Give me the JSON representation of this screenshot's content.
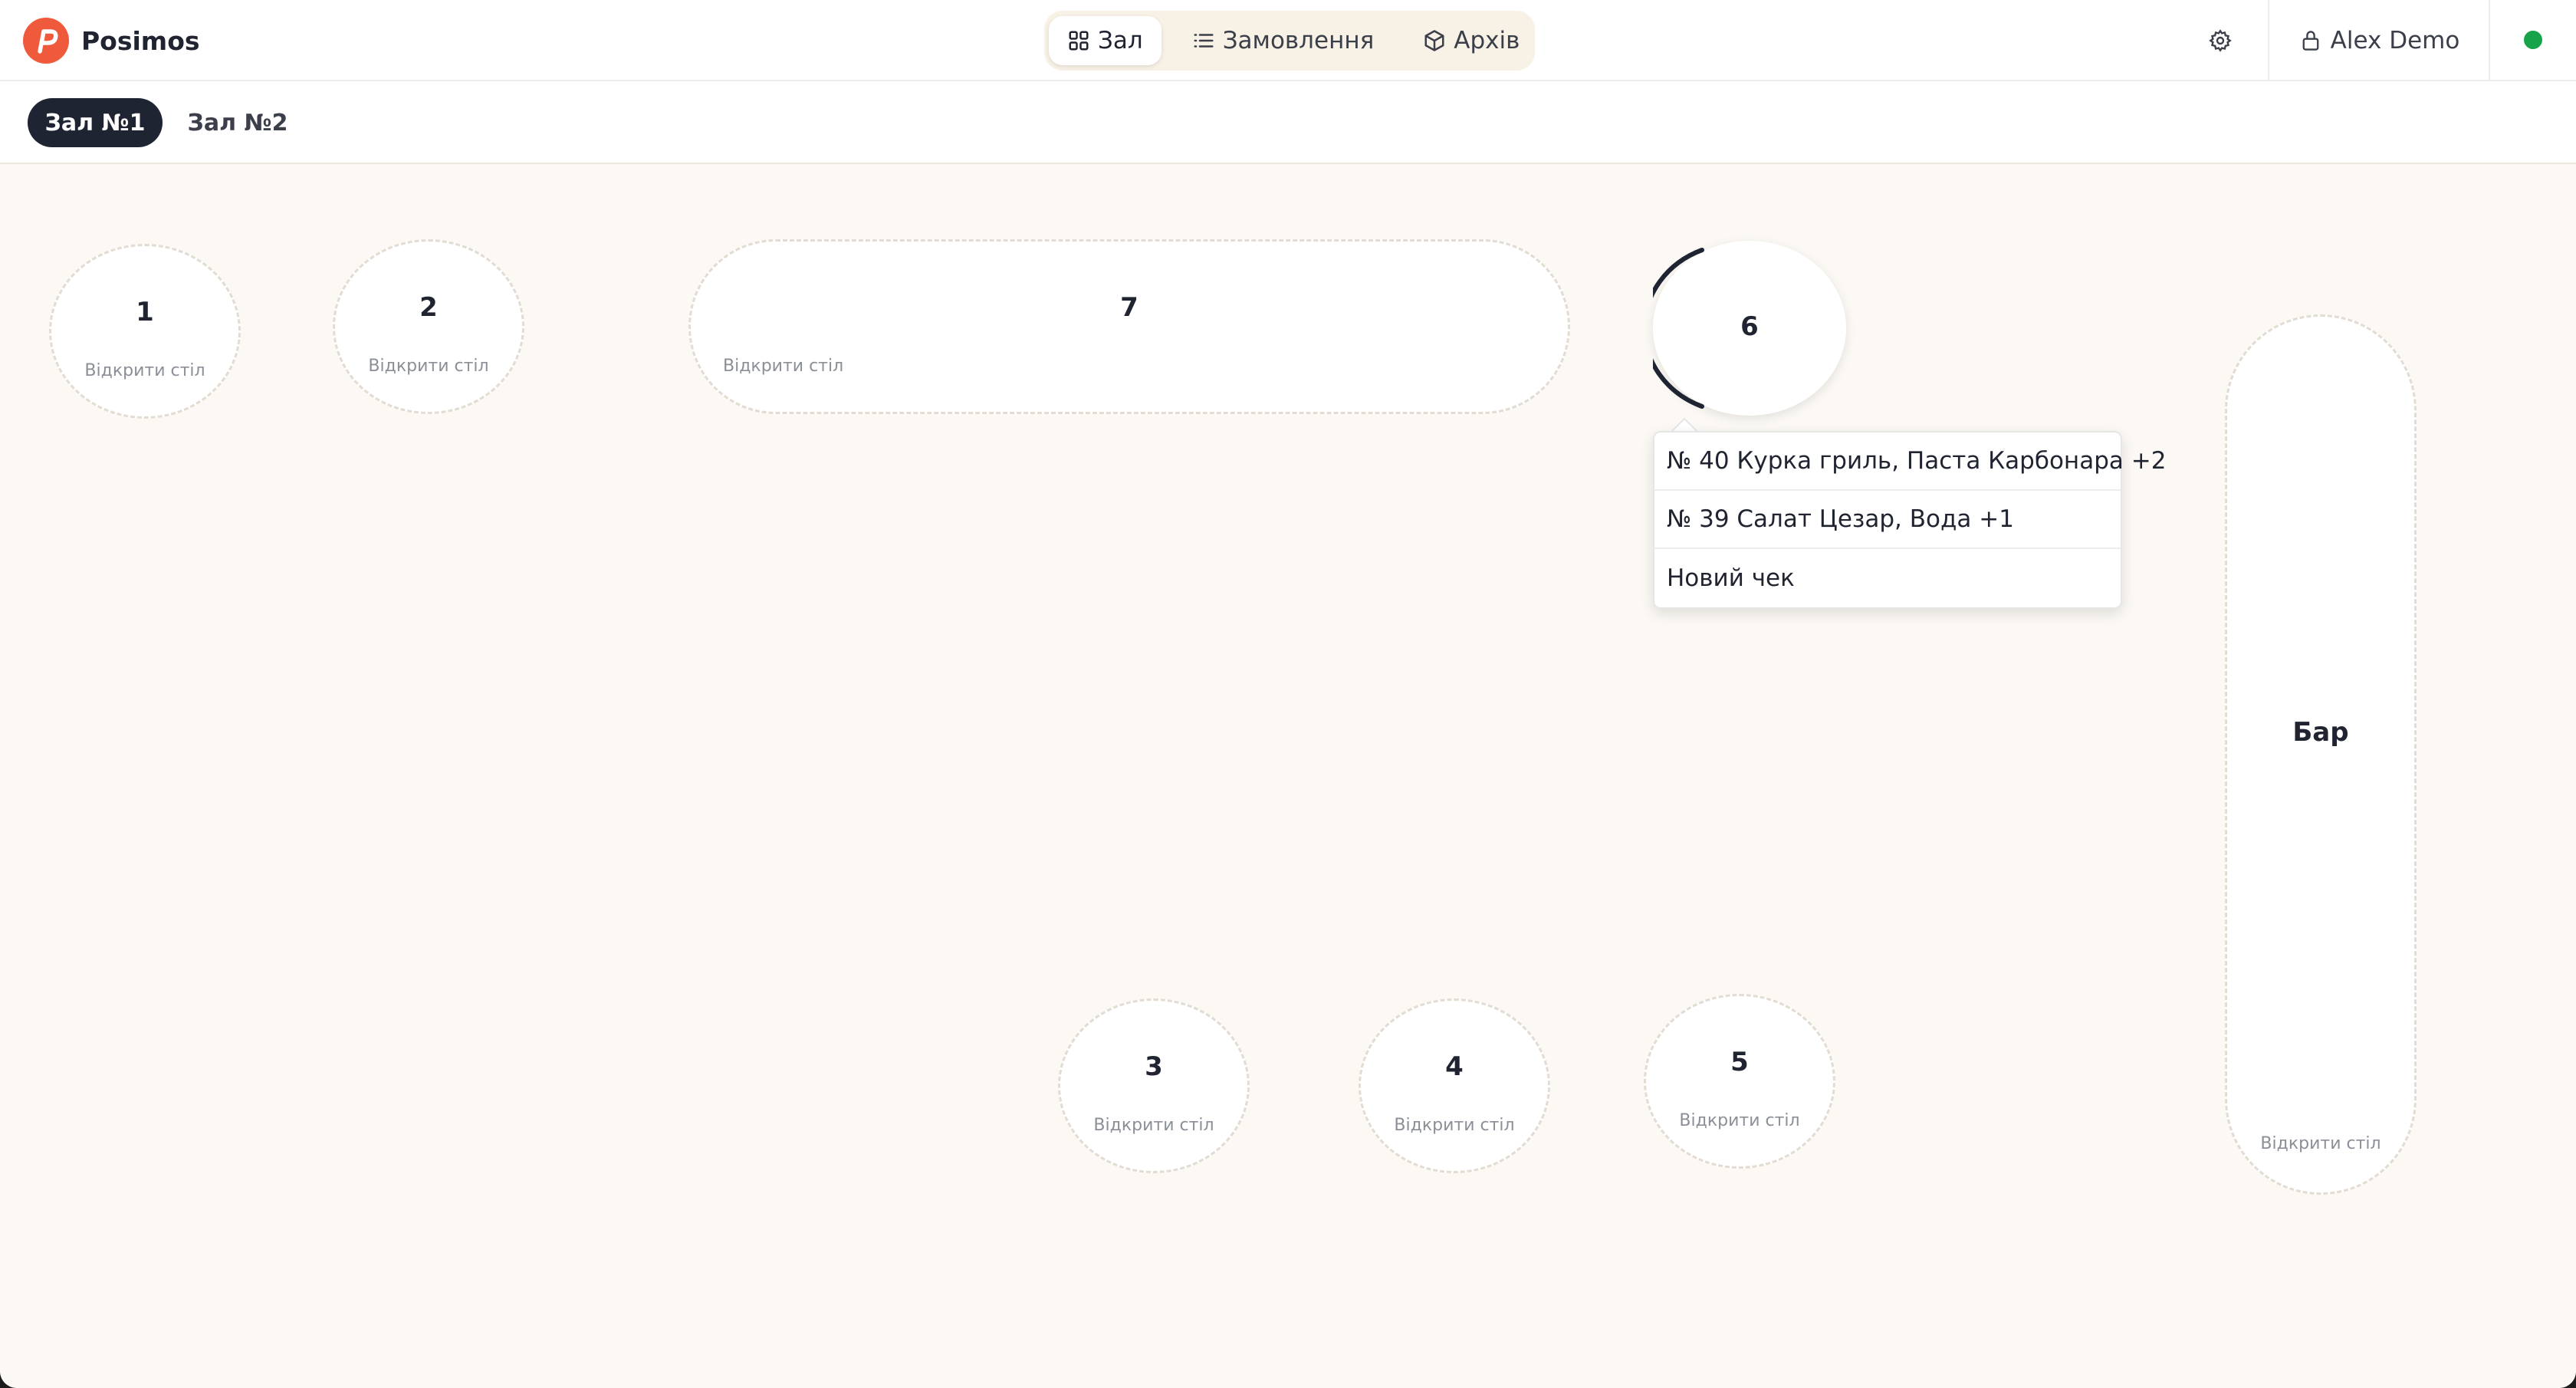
{
  "app": {
    "brand_name": "Posimos",
    "brand_color": "#ef5a3c"
  },
  "nav": {
    "tabs": [
      {
        "label": "Зал",
        "icon": "grid-icon",
        "active": true
      },
      {
        "label": "Замовлення",
        "icon": "list-icon",
        "active": false
      },
      {
        "label": "Архів",
        "icon": "box-icon",
        "active": false
      }
    ]
  },
  "header": {
    "settings_icon": "gear-icon",
    "user_icon": "lock-icon",
    "user_name": "Alex Demo",
    "status_color": "#16a34a"
  },
  "halls": {
    "tabs": [
      {
        "label": "Зал №1",
        "active": true
      },
      {
        "label": "Зал №2",
        "active": false
      }
    ]
  },
  "floor": {
    "open_table_label": "Відкрити стіл",
    "tables": {
      "t1": {
        "name": "1"
      },
      "t2": {
        "name": "2"
      },
      "t3": {
        "name": "3"
      },
      "t4": {
        "name": "4"
      },
      "t5": {
        "name": "5"
      },
      "t6": {
        "name": "6"
      },
      "t7": {
        "name": "7"
      },
      "bar": {
        "name": "Бар"
      }
    }
  },
  "popup": {
    "items": [
      "№ 40 Курка гриль, Паста Карбонара +2",
      "№ 39 Салат Цезар, Вода +1",
      "Новий чек"
    ]
  }
}
